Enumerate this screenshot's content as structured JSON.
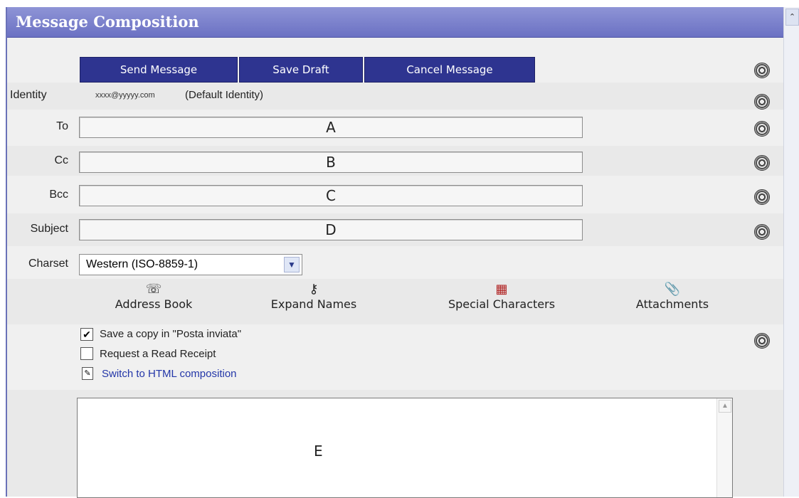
{
  "window": {
    "title": "Message Composition"
  },
  "toolbar": {
    "send_label": "Send Message",
    "save_label": "Save Draft",
    "cancel_label": "Cancel Message"
  },
  "identity": {
    "label": "Identity",
    "email": "xxxx@yyyyy.com",
    "default_note": "(Default Identity)"
  },
  "fields": {
    "to": {
      "label": "To",
      "value": "A"
    },
    "cc": {
      "label": "Cc",
      "value": "B"
    },
    "bcc": {
      "label": "Bcc",
      "value": "C"
    },
    "subject": {
      "label": "Subject",
      "value": "D"
    }
  },
  "charset": {
    "label": "Charset",
    "selected": "Western (ISO-8859-1)"
  },
  "tools": {
    "address_book": "Address Book",
    "expand_names": "Expand Names",
    "special_chars": "Special Characters",
    "attachments": "Attachments"
  },
  "options": {
    "save_copy": {
      "label": "Save a copy in \"Posta inviata\"",
      "checked": true
    },
    "read_receipt": {
      "label": "Request a Read Receipt",
      "checked": false
    },
    "switch_html": "Switch to HTML composition"
  },
  "body": {
    "text": "E"
  },
  "icons": {
    "spellcheck": "spellcheck-icon",
    "address_book": "address-book-icon",
    "expand_names": "expand-names-icon",
    "special_chars": "special-characters-icon",
    "attachments": "paperclip-icon",
    "switch_html": "edit-document-icon"
  },
  "colors": {
    "titlebar": "#7a80cc",
    "button": "#2e3490",
    "link": "#2336a8"
  }
}
